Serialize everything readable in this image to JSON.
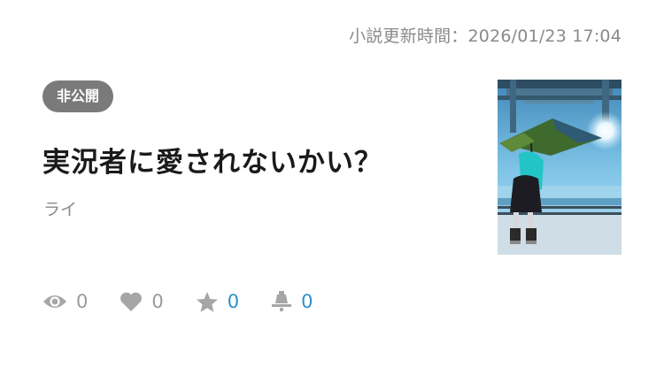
{
  "updated_text": "小説更新時間：2026/01/23 17:04",
  "badge": "非公開",
  "title": "実況者に愛されないかい？",
  "author": "ライ",
  "thumbnail": {
    "image": "cover-illustration"
  },
  "stats": {
    "views": {
      "icon": "eye-icon",
      "value": "0",
      "color": "#9a9a9a"
    },
    "likes": {
      "icon": "heart-icon",
      "value": "0",
      "color": "#9a9a9a"
    },
    "favorites": {
      "icon": "star-icon",
      "value": "0",
      "color": "#2f8fc8"
    },
    "comments": {
      "icon": "lamp-icon",
      "value": "0",
      "color": "#2f8fc8"
    }
  }
}
